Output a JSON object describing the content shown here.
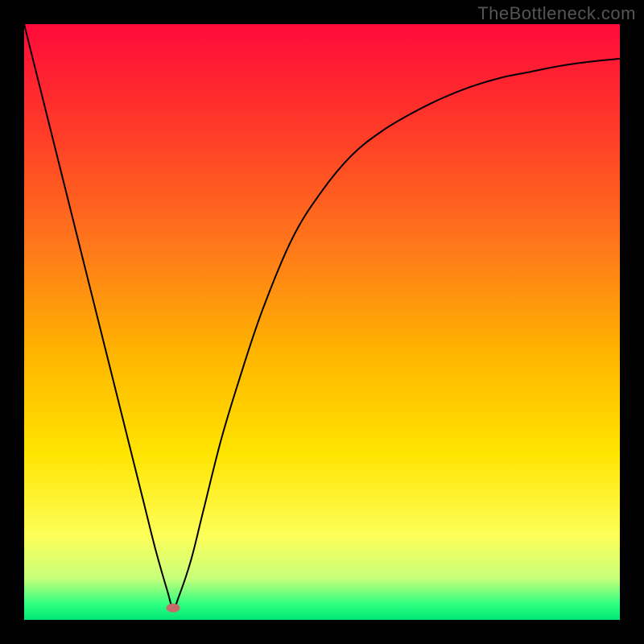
{
  "watermark": "TheBottleneck.com",
  "colors": {
    "frame": "#000000",
    "watermark": "#555555",
    "curve": "#000000",
    "marker_fill": "#c86a6a",
    "marker_stroke": "#c86a6a",
    "gradient_stops": [
      {
        "offset": 0.0,
        "color": "#ff0a3a"
      },
      {
        "offset": 0.18,
        "color": "#ff3b28"
      },
      {
        "offset": 0.38,
        "color": "#ff7a1a"
      },
      {
        "offset": 0.55,
        "color": "#ffb400"
      },
      {
        "offset": 0.72,
        "color": "#ffe400"
      },
      {
        "offset": 0.86,
        "color": "#fdff5a"
      },
      {
        "offset": 0.93,
        "color": "#c8ff7a"
      },
      {
        "offset": 0.975,
        "color": "#2bff80"
      },
      {
        "offset": 1.0,
        "color": "#00e676"
      }
    ]
  },
  "chart_data": {
    "type": "line",
    "title": "",
    "xlabel": "",
    "ylabel": "",
    "xlim": [
      0,
      100
    ],
    "ylim": [
      0,
      100
    ],
    "grid": false,
    "legend": false,
    "series": [
      {
        "name": "bottleneck-curve",
        "x": [
          0,
          2,
          5,
          8,
          11,
          14,
          17,
          20,
          22,
          24,
          25,
          26,
          28,
          30,
          33,
          36,
          40,
          45,
          50,
          55,
          60,
          65,
          70,
          75,
          80,
          85,
          90,
          95,
          100
        ],
        "values": [
          100,
          92,
          80,
          68,
          56,
          44,
          32,
          20,
          12,
          5,
          2,
          4,
          10,
          18,
          30,
          40,
          52,
          64,
          72,
          78,
          82,
          85,
          87.5,
          89.5,
          91,
          92,
          93,
          93.7,
          94.2
        ]
      }
    ],
    "optimum_marker": {
      "x": 25,
      "y": 2
    }
  }
}
